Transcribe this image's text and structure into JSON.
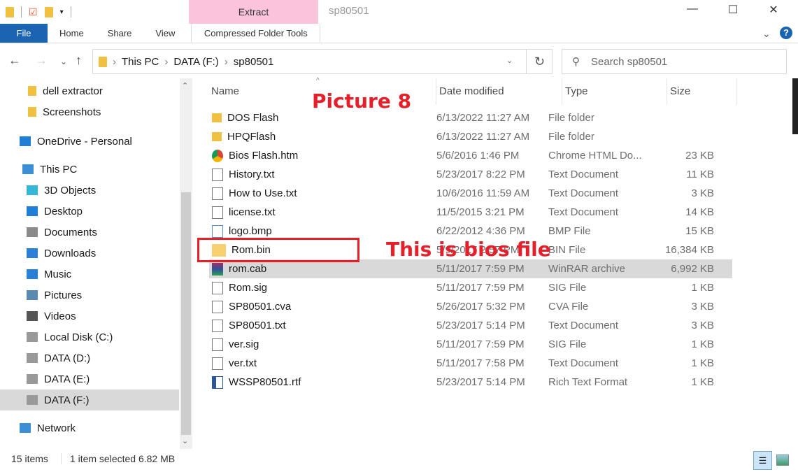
{
  "window": {
    "title": "sp80501",
    "context_tab": "Extract",
    "minimize": "—",
    "maximize": "☐",
    "close": "✕",
    "help": "?",
    "expand": "⌄"
  },
  "ribbon": {
    "tabs": [
      "File",
      "Home",
      "Share",
      "View"
    ],
    "context_tab": "Compressed Folder Tools"
  },
  "address": {
    "crumbs": [
      "This PC",
      "DATA (F:)",
      "sp80501"
    ],
    "search_placeholder": "Search sp80501"
  },
  "sidebar": [
    {
      "label": "dell extractor",
      "icon": "folder-icon"
    },
    {
      "label": "Screenshots",
      "icon": "folder-icon"
    },
    {
      "label": "OneDrive - Personal",
      "icon": "cloud-icon"
    },
    {
      "label": "This PC",
      "icon": "pc-icon"
    },
    {
      "label": "3D Objects",
      "icon": "cube-icon"
    },
    {
      "label": "Desktop",
      "icon": "desktop-icon"
    },
    {
      "label": "Documents",
      "icon": "documents-icon"
    },
    {
      "label": "Downloads",
      "icon": "download-icon"
    },
    {
      "label": "Music",
      "icon": "music-icon"
    },
    {
      "label": "Pictures",
      "icon": "pictures-icon"
    },
    {
      "label": "Videos",
      "icon": "videos-icon"
    },
    {
      "label": "Local Disk (C:)",
      "icon": "drive-icon"
    },
    {
      "label": "DATA (D:)",
      "icon": "drive-icon"
    },
    {
      "label": "DATA (E:)",
      "icon": "drive-icon"
    },
    {
      "label": "DATA (F:)",
      "icon": "drive-icon"
    },
    {
      "label": "Network",
      "icon": "network-icon"
    }
  ],
  "columns": [
    "Name",
    "Date modified",
    "Type",
    "Size"
  ],
  "files": [
    {
      "name": "DOS Flash",
      "date": "6/13/2022 11:27 AM",
      "type": "File folder",
      "size": ""
    },
    {
      "name": "HPQFlash",
      "date": "6/13/2022 11:27 AM",
      "type": "File folder",
      "size": ""
    },
    {
      "name": "Bios Flash.htm",
      "date": "5/6/2016 1:46 PM",
      "type": "Chrome HTML Do...",
      "size": "23 KB"
    },
    {
      "name": "History.txt",
      "date": "5/23/2017 8:22 PM",
      "type": "Text Document",
      "size": "11 KB"
    },
    {
      "name": "How to Use.txt",
      "date": "10/6/2016 11:59 AM",
      "type": "Text Document",
      "size": "3 KB"
    },
    {
      "name": "license.txt",
      "date": "11/5/2015 3:21 PM",
      "type": "Text Document",
      "size": "14 KB"
    },
    {
      "name": "logo.bmp",
      "date": "6/22/2012 4:36 PM",
      "type": "BMP File",
      "size": "15 KB"
    },
    {
      "name": "Rom.bin",
      "date": "5/9/2017 2:57 PM",
      "type": "BIN File",
      "size": "16,384 KB"
    },
    {
      "name": "rom.cab",
      "date": "5/11/2017 7:59 PM",
      "type": "WinRAR archive",
      "size": "6,992 KB"
    },
    {
      "name": "Rom.sig",
      "date": "5/11/2017 7:59 PM",
      "type": "SIG File",
      "size": "1 KB"
    },
    {
      "name": "SP80501.cva",
      "date": "5/26/2017 5:32 PM",
      "type": "CVA File",
      "size": "3 KB"
    },
    {
      "name": "SP80501.txt",
      "date": "5/23/2017 5:14 PM",
      "type": "Text Document",
      "size": "3 KB"
    },
    {
      "name": "ver.sig",
      "date": "5/11/2017 7:59 PM",
      "type": "SIG File",
      "size": "1 KB"
    },
    {
      "name": "ver.txt",
      "date": "5/11/2017 7:58 PM",
      "type": "Text Document",
      "size": "1 KB"
    },
    {
      "name": "WSSP80501.rtf",
      "date": "5/23/2017 5:14 PM",
      "type": "Rich Text Format",
      "size": "1 KB"
    }
  ],
  "annotations": {
    "picture": "Picture 8",
    "bios": "This is bios file"
  },
  "status": {
    "count": "15 items",
    "selected": "1 item selected  6.82 MB"
  }
}
